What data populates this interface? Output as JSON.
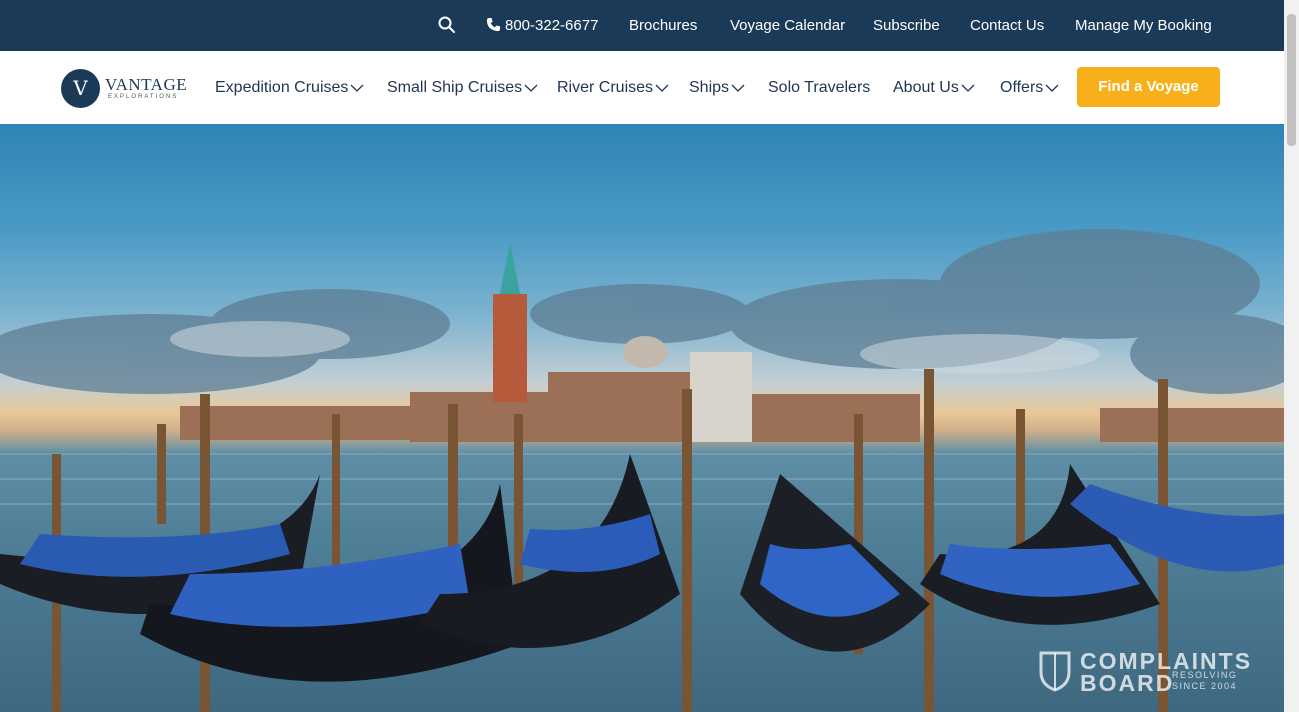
{
  "topbar": {
    "phone": "800-322-6677",
    "links": [
      "Brochures",
      "Voyage Calendar",
      "Subscribe",
      "Contact Us",
      "Manage My Booking"
    ]
  },
  "logo": {
    "mark": "V",
    "name": "VANTAGE",
    "tagline": "EXPLORATIONS"
  },
  "nav": {
    "items": [
      {
        "label": "Expedition Cruises"
      },
      {
        "label": "Small Ship Cruises"
      },
      {
        "label": "River Cruises"
      },
      {
        "label": "Ships"
      },
      {
        "label": "Solo Travelers"
      },
      {
        "label": "About Us"
      },
      {
        "label": "Offers"
      }
    ],
    "cta": "Find a Voyage"
  },
  "watermark": {
    "line1": "COMPLAINTS",
    "line2": "BOARD",
    "line3": "RESOLVING",
    "line4": "SINCE 2004"
  },
  "colors": {
    "topbar": "#1b3a58",
    "cta": "#f7b01a",
    "nav_text": "#1f3550"
  },
  "icons": [
    "search-icon",
    "phone-icon",
    "chevron-down-icon",
    "shield-icon"
  ]
}
